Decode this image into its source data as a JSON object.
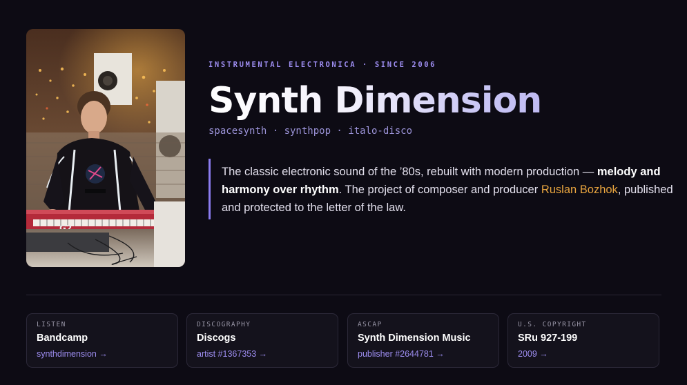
{
  "hero": {
    "eyebrow": "INSTRUMENTAL ELECTRONICA · SINCE 2006",
    "title": "Synth Dimension",
    "genres": "spacesynth · synthpop · italo-disco",
    "description": {
      "part1": "The classic electronic sound of the ’80s, rebuilt with modern production — ",
      "bold": "melody and harmony over rhythm",
      "part2": ". The project of composer and producer ",
      "accent": "Ruslan Bozhok",
      "part3": ", published and protected to the letter of the law."
    }
  },
  "photo": {
    "alt_icon": "artist-photo",
    "keyboard_text": "G2"
  },
  "links": [
    {
      "key": "LISTEN",
      "value": "Bandcamp",
      "link": "synthdimension →"
    },
    {
      "key": "DISCOGRAPHY",
      "value": "Discogs",
      "link": "artist #1367353 →"
    },
    {
      "key": "ASCAP",
      "value": "Synth Dimension Music",
      "link": "publisher #2644781 →"
    },
    {
      "key": "U.S. COPYRIGHT",
      "value": "SRu 927-199",
      "link": "2009 →"
    }
  ],
  "colors": {
    "background": "#0d0b14",
    "accent_purple": "#9d8df0",
    "accent_orange": "#e9a53f",
    "card_bg": "#14121c"
  }
}
